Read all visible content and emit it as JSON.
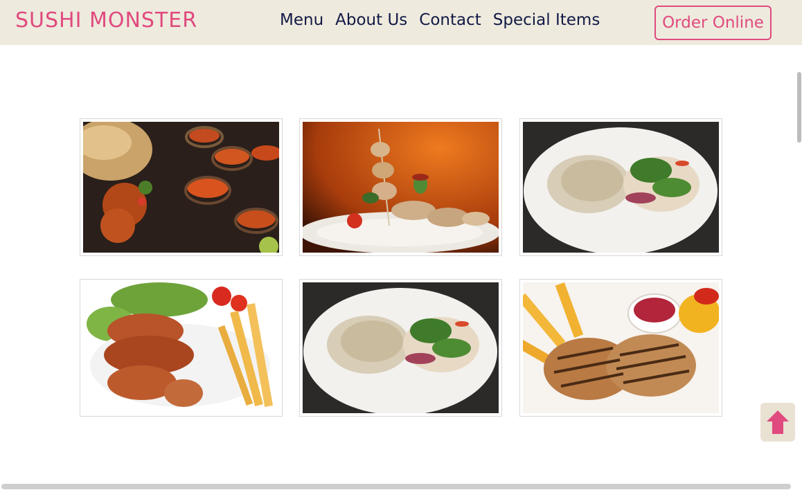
{
  "header": {
    "brand": "SUSHI MONSTER",
    "nav": [
      {
        "label": "Menu"
      },
      {
        "label": "About Us"
      },
      {
        "label": "Contact"
      },
      {
        "label": "Special Items"
      }
    ],
    "order_button": "Order Online"
  },
  "colors": {
    "brand": "#e04a7e",
    "nav_text": "#121a44",
    "navbar_bg": "#eeeade",
    "back_to_top_arrow": "#e04a7e"
  },
  "gallery": {
    "items": [
      {
        "name": "curry-and-naan-photo"
      },
      {
        "name": "chicken-skewer-photo"
      },
      {
        "name": "rice-and-salad-plate-photo"
      },
      {
        "name": "roast-chicken-legs-photo"
      },
      {
        "name": "rice-and-salad-plate-photo-2"
      },
      {
        "name": "grilled-patties-photo"
      }
    ]
  },
  "back_to_top": {
    "icon": "arrow-up-icon"
  }
}
